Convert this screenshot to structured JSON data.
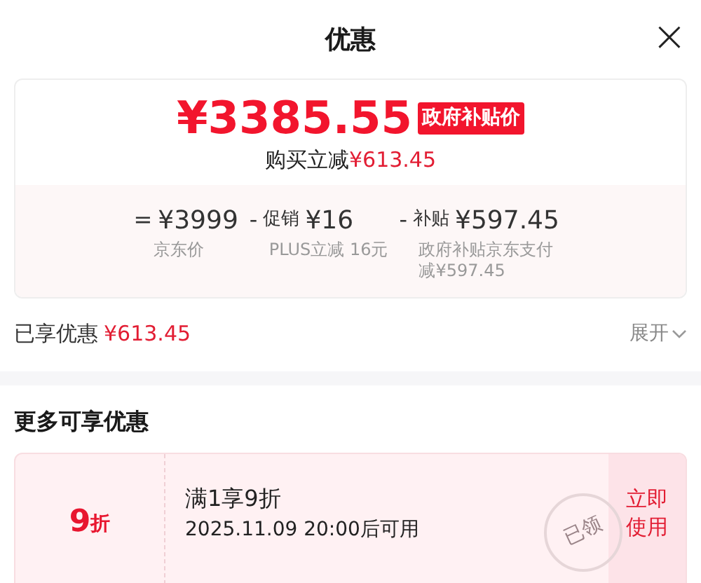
{
  "header": {
    "title": "优惠",
    "close": "×"
  },
  "price_card": {
    "price": "¥3385.55",
    "badge": "政府补贴价",
    "saving_label": "购买立减",
    "saving_amount": "¥613.45",
    "breakdown": [
      {
        "op": "=",
        "amount": "¥3999",
        "note": "京东价"
      },
      {
        "op": "-",
        "name": "促销",
        "amount": "¥16",
        "note": "PLUS立减 16元"
      },
      {
        "op": "-",
        "name": "补贴",
        "amount": "¥597.45",
        "note": "政府补贴京东支付减¥597.45"
      }
    ]
  },
  "summary": {
    "label": "已享优惠",
    "amount": "¥613.45",
    "toggle": "展开",
    "expanded": false
  },
  "more": {
    "title": "更多可享优惠",
    "coupons": [
      {
        "value": "9",
        "unit": "折",
        "title": "满1享9折",
        "time": "2025.11.09 20:00后可用",
        "action": "立即使用",
        "claimed": true,
        "stamp": "已领"
      }
    ]
  }
}
